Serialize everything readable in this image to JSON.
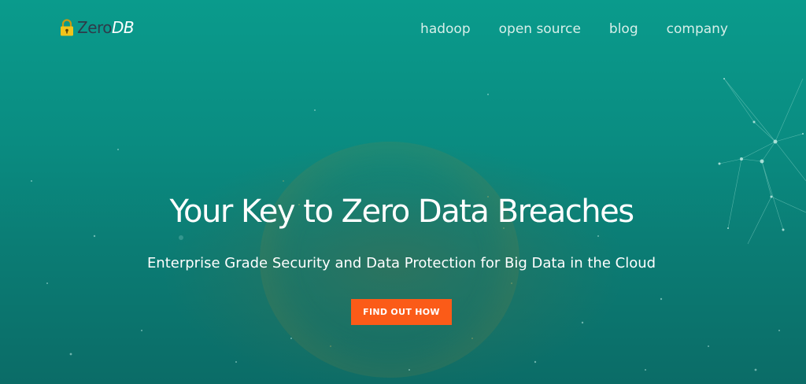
{
  "brand": {
    "name_prefix": "Zero",
    "name_suffix": "DB",
    "icon": "lock-icon"
  },
  "nav": {
    "items": [
      {
        "label": "hadoop"
      },
      {
        "label": "open source"
      },
      {
        "label": "blog"
      },
      {
        "label": "company"
      }
    ]
  },
  "hero": {
    "headline": "Your Key to Zero Data Breaches",
    "subheadline": "Enterprise Grade Security and Data Protection for Big Data in the Cloud",
    "cta_label": "FIND OUT HOW"
  },
  "colors": {
    "background_teal": "#0a9b8c",
    "cta_orange": "#fb5b18",
    "lock_yellow": "#f2c41b",
    "logo_dark": "#2e3b4a"
  }
}
